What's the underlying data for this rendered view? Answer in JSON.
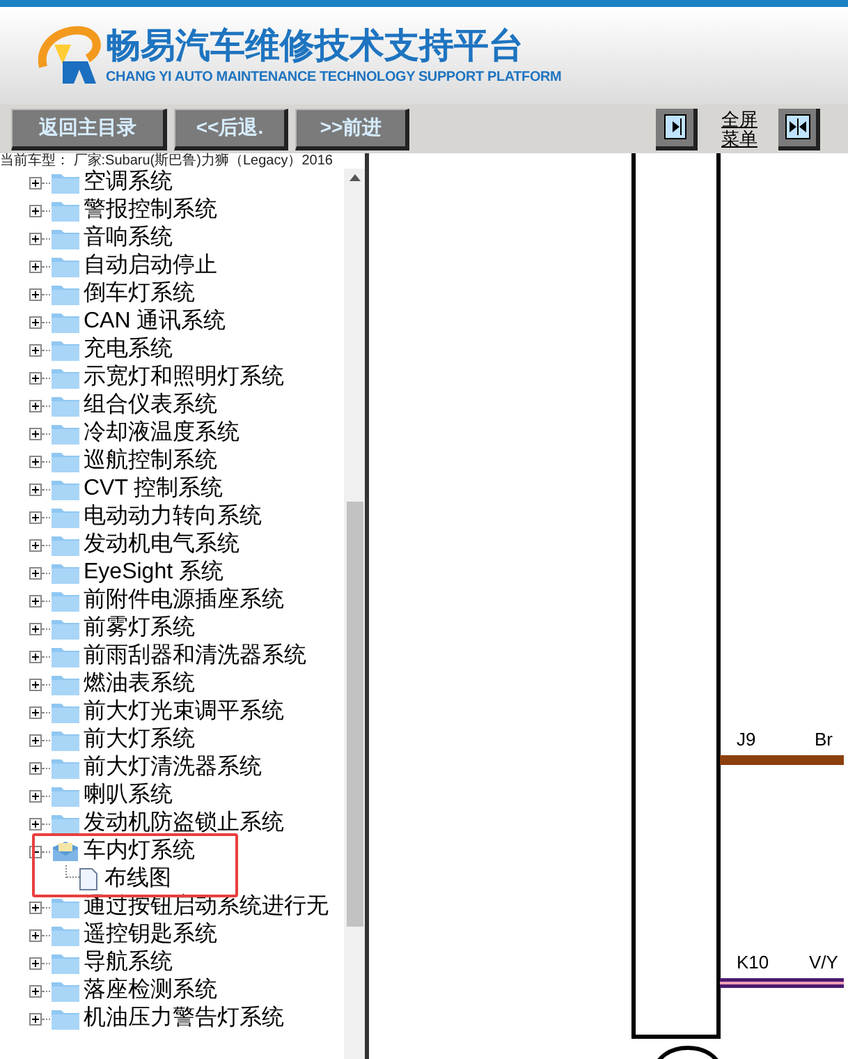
{
  "header": {
    "title": "畅易汽车维修技术支持平台",
    "subtitle": "CHANG YI AUTO MAINTENANCE TECHNOLOGY SUPPORT PLATFORM"
  },
  "toolbar": {
    "buttons": [
      "返回主目录",
      "<<后退.",
      ">>前进"
    ],
    "fullscreen_label": "全屏菜单"
  },
  "vehicle_info": "当前车型： 厂家:Subaru(斯巴鲁)力狮（Legacy）2016",
  "tree": [
    {
      "label": "空调系统",
      "expanded": false
    },
    {
      "label": "警报控制系统",
      "expanded": false
    },
    {
      "label": "音响系统",
      "expanded": false
    },
    {
      "label": "自动启动停止",
      "expanded": false
    },
    {
      "label": "倒车灯系统",
      "expanded": false
    },
    {
      "label": "CAN 通讯系统",
      "expanded": false
    },
    {
      "label": "充电系统",
      "expanded": false
    },
    {
      "label": "示宽灯和照明灯系统",
      "expanded": false
    },
    {
      "label": "组合仪表系统",
      "expanded": false
    },
    {
      "label": "冷却液温度系统",
      "expanded": false
    },
    {
      "label": "巡航控制系统",
      "expanded": false
    },
    {
      "label": "CVT 控制系统",
      "expanded": false
    },
    {
      "label": "电动动力转向系统",
      "expanded": false
    },
    {
      "label": "发动机电气系统",
      "expanded": false
    },
    {
      "label": "EyeSight 系统",
      "expanded": false
    },
    {
      "label": "前附件电源插座系统",
      "expanded": false
    },
    {
      "label": "前雾灯系统",
      "expanded": false
    },
    {
      "label": "前雨刮器和清洗器系统",
      "expanded": false
    },
    {
      "label": "燃油表系统",
      "expanded": false
    },
    {
      "label": "前大灯光束调平系统",
      "expanded": false
    },
    {
      "label": "前大灯系统",
      "expanded": false
    },
    {
      "label": "前大灯清洗器系统",
      "expanded": false
    },
    {
      "label": "喇叭系统",
      "expanded": false
    },
    {
      "label": "发动机防盗锁止系统",
      "expanded": false
    },
    {
      "label": "车内灯系统",
      "expanded": true,
      "highlighted": true,
      "children": [
        {
          "label": "布线图"
        }
      ]
    },
    {
      "label": "通过按钮启动系统进行无",
      "expanded": false
    },
    {
      "label": "遥控钥匙系统",
      "expanded": false
    },
    {
      "label": "导航系统",
      "expanded": false
    },
    {
      "label": "落座检测系统",
      "expanded": false
    },
    {
      "label": "机油压力警告灯系统",
      "expanded": false
    }
  ],
  "diagram": {
    "wires": [
      {
        "pin": "J9",
        "color_code": "Br",
        "color": "#8b3f0c"
      },
      {
        "pin": "K10",
        "color_code": "V/Y",
        "color": "#4a1a6e"
      }
    ]
  }
}
